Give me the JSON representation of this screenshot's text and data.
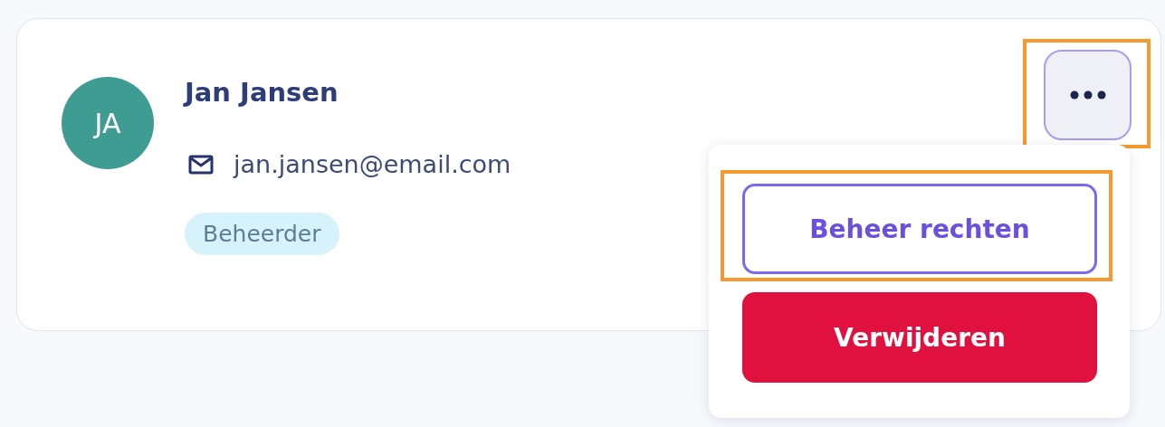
{
  "user": {
    "initials": "JA",
    "name": "Jan Jansen",
    "email": "jan.jansen@email.com",
    "role": "Beheerder"
  },
  "more_button": {
    "highlighted": true,
    "expanded": true
  },
  "menu": {
    "items": [
      {
        "label": "Beheer rechten",
        "kind": "outline",
        "highlighted": true
      },
      {
        "label": "Verwijderen",
        "kind": "danger",
        "highlighted": false
      }
    ]
  }
}
